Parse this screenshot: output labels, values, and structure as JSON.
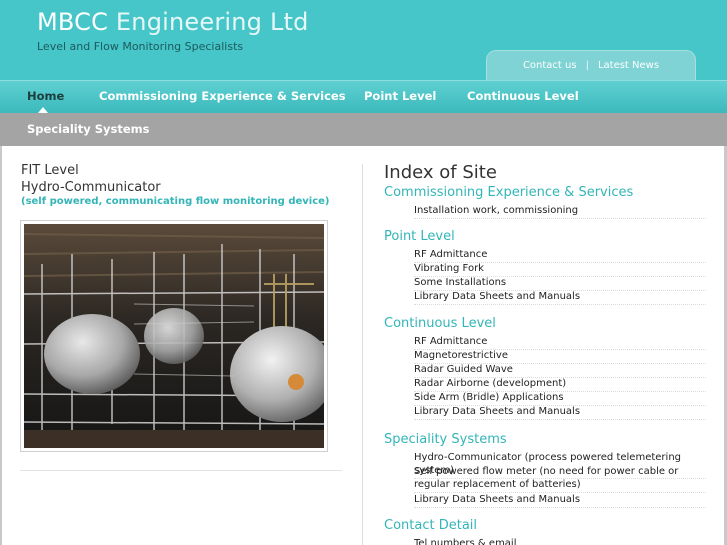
{
  "header": {
    "brand_main": "MBCC",
    "brand_rest": "Engineering Ltd",
    "tagline": "Level and Flow Monitoring Specialists",
    "contact_label": "Contact us",
    "separator": "|",
    "news_label": "Latest News"
  },
  "nav": {
    "home": "Home",
    "commissioning": "Commissioning Experience & Services",
    "point_level": "Point Level",
    "continuous_level": "Continuous Level",
    "speciality": "Speciality Systems"
  },
  "left": {
    "title_line1": "FIT Level",
    "title_line2": "Hydro-Communicator",
    "subtitle": "(self powered, communicating flow monitoring device)"
  },
  "index": {
    "title": "Index of Site",
    "sections": [
      {
        "heading": "Commissioning Experience & Services",
        "items": [
          "Installation work, commissioning"
        ]
      },
      {
        "heading": "Point Level",
        "items": [
          "RF Admittance",
          "Vibrating Fork",
          "Some Installations",
          "Library Data Sheets and Manuals"
        ]
      },
      {
        "heading": "Continuous Level",
        "items": [
          "RF Admittance",
          "Magnetorestrictive",
          "Radar Guided Wave",
          "Radar Airborne (development)",
          "Side Arm (Bridle) Applications",
          "Library Data Sheets and Manuals"
        ]
      },
      {
        "heading": "Speciality Systems",
        "items": [
          "Hydro-Communicator (process powered telemetering system)",
          "Self powered flow meter (no need for power cable or regular replacement of batteries)",
          "Library Data Sheets and Manuals"
        ]
      },
      {
        "heading": "Contact Detail",
        "items": [
          "Tel numbers & email"
        ]
      }
    ]
  }
}
